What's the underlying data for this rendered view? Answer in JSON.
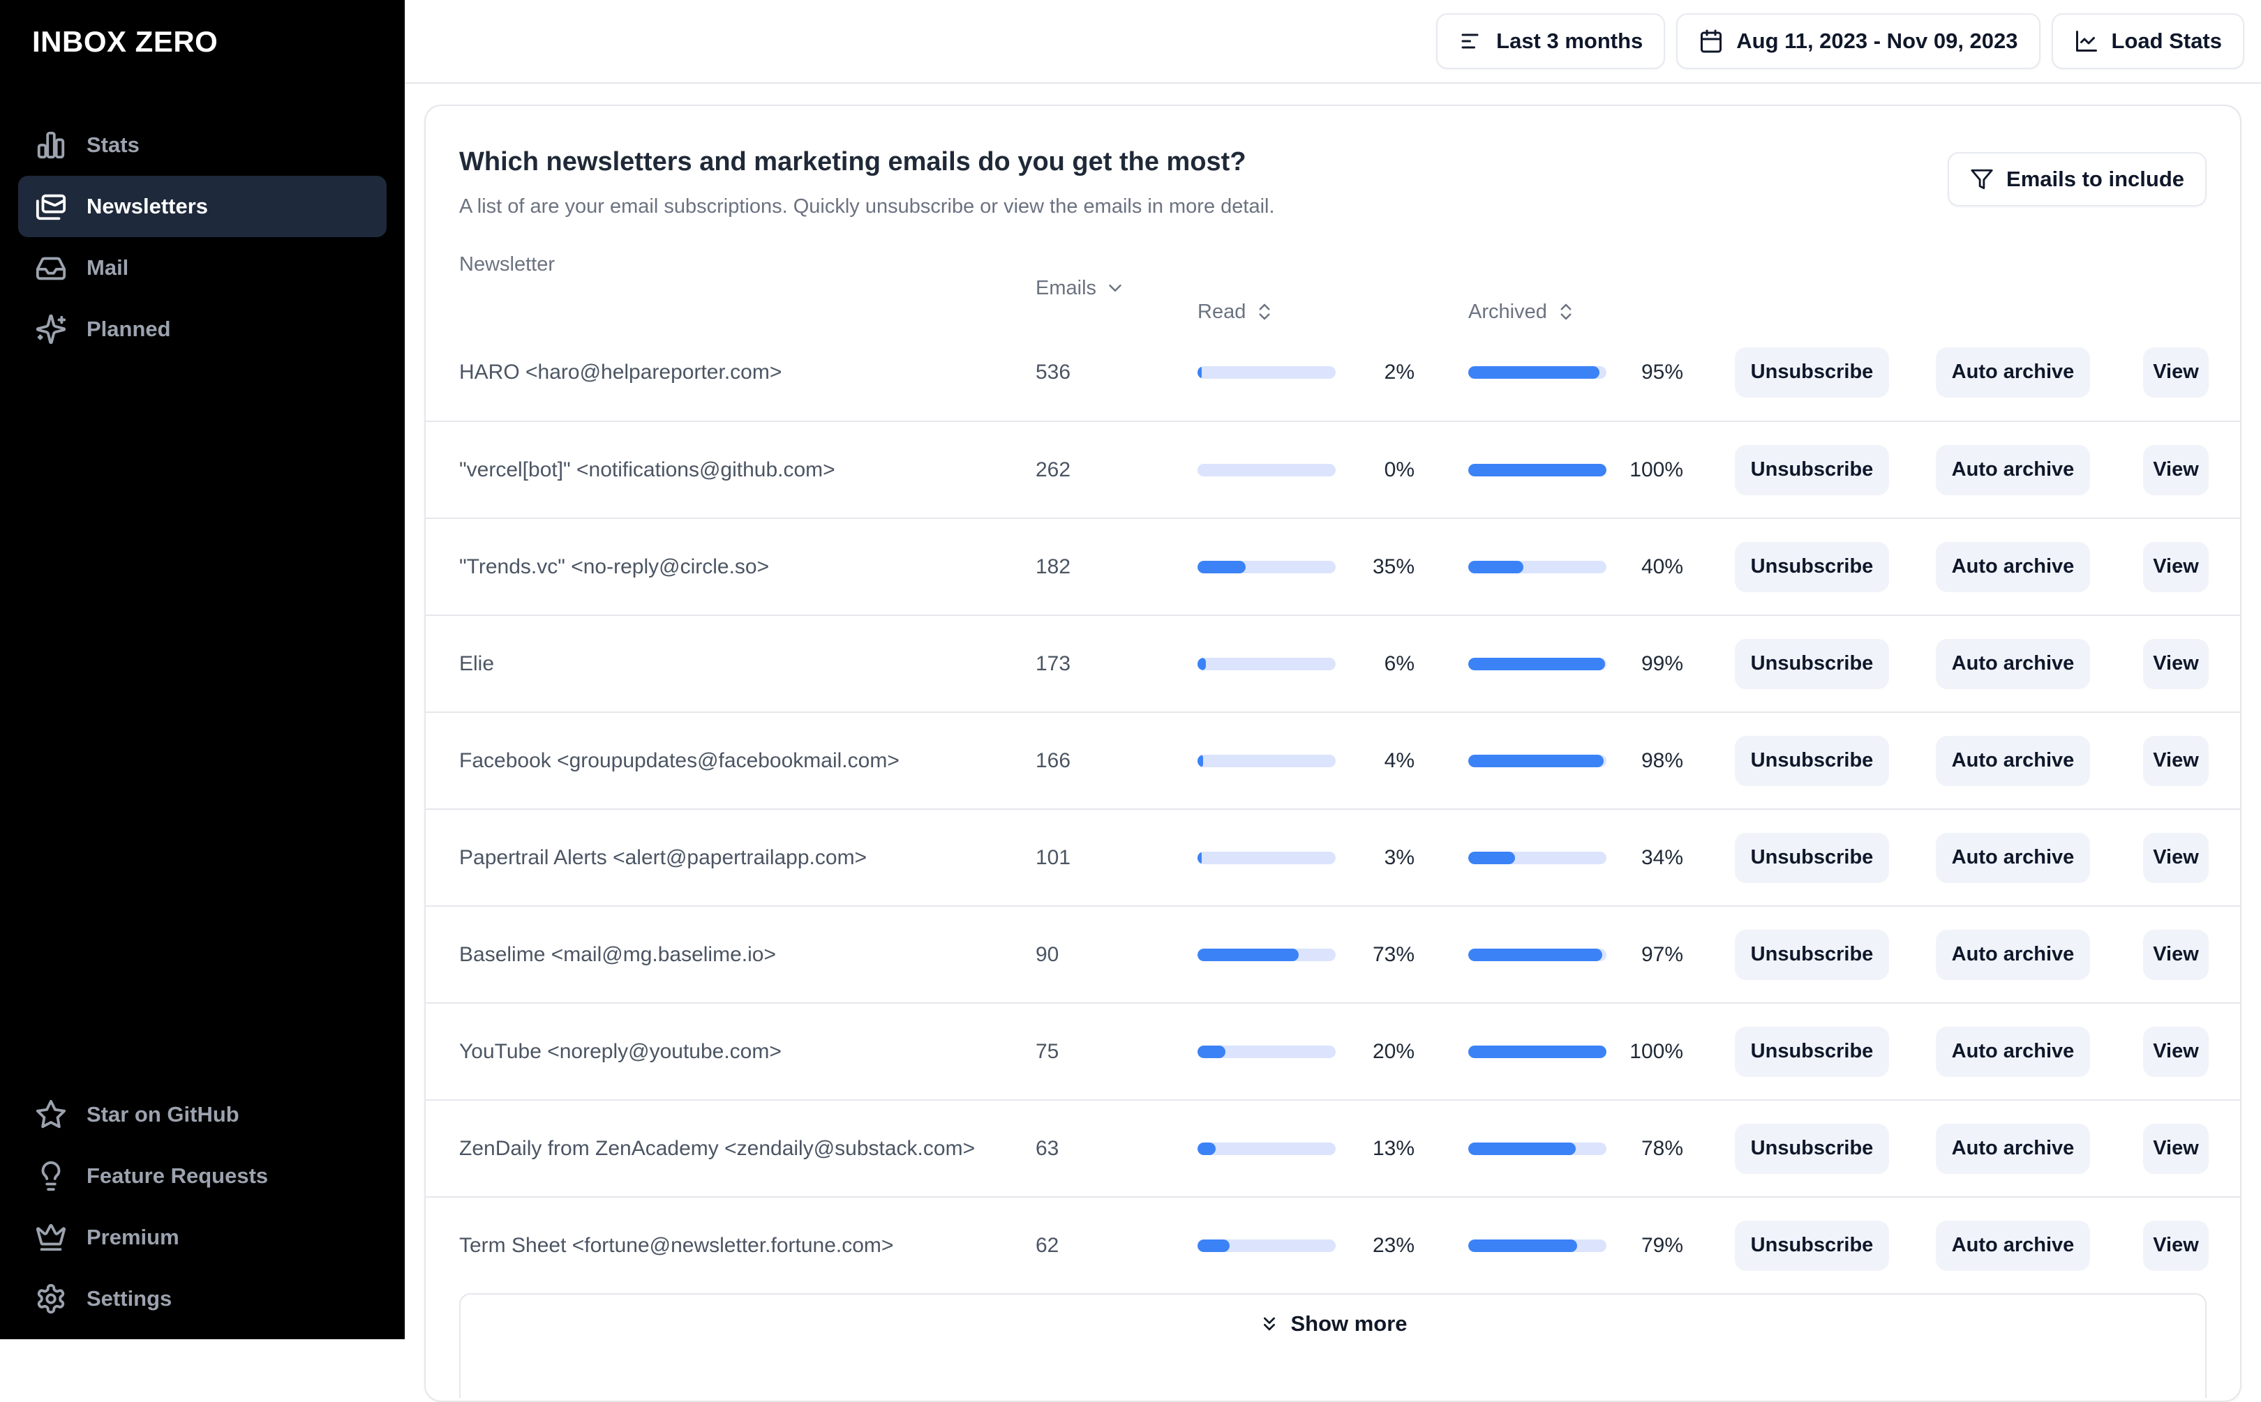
{
  "sidebar": {
    "logo": "INBOX ZERO",
    "nav": [
      {
        "label": "Stats",
        "icon": "bar-chart-icon",
        "active": false
      },
      {
        "label": "Newsletters",
        "icon": "newsletters-icon",
        "active": true
      },
      {
        "label": "Mail",
        "icon": "inbox-icon",
        "active": false
      },
      {
        "label": "Planned",
        "icon": "sparkles-icon",
        "active": false
      }
    ],
    "footer_nav": [
      {
        "label": "Star on GitHub",
        "icon": "star-icon"
      },
      {
        "label": "Feature Requests",
        "icon": "lightbulb-icon"
      },
      {
        "label": "Premium",
        "icon": "crown-icon"
      },
      {
        "label": "Settings",
        "icon": "gear-icon"
      }
    ]
  },
  "topbar": {
    "period_button": {
      "label": "Last 3 months",
      "icon": "filter-lines-icon"
    },
    "date_button": {
      "label": "Aug 11, 2023 - Nov 09, 2023",
      "icon": "calendar-icon"
    },
    "load_stats_button": {
      "label": "Load Stats",
      "icon": "line-chart-icon"
    }
  },
  "panel": {
    "title": "Which newsletters and marketing emails do you get the most?",
    "subtitle": "A list of are your email subscriptions. Quickly unsubscribe or view the emails in more detail.",
    "filter_button": {
      "label": "Emails to include",
      "icon": "funnel-icon"
    },
    "table": {
      "columns": [
        {
          "label": "Newsletter",
          "sort": "none"
        },
        {
          "label": "Emails",
          "sort": "down"
        },
        {
          "label": "Read",
          "sort": "updown"
        },
        {
          "label": "Archived",
          "sort": "updown"
        }
      ],
      "actions": [
        "Unsubscribe",
        "Auto archive",
        "View"
      ],
      "rows": [
        {
          "name": "HARO <haro@helpareporter.com>",
          "emails": 536,
          "read_pct": 2,
          "archived_pct": 95
        },
        {
          "name": "\"vercel[bot]\" <notifications@github.com>",
          "emails": 262,
          "read_pct": 0,
          "archived_pct": 100
        },
        {
          "name": "\"Trends.vc\" <no-reply@circle.so>",
          "emails": 182,
          "read_pct": 35,
          "archived_pct": 40
        },
        {
          "name": "Elie",
          "emails": 173,
          "read_pct": 6,
          "archived_pct": 99
        },
        {
          "name": "Facebook <groupupdates@facebookmail.com>",
          "emails": 166,
          "read_pct": 4,
          "archived_pct": 98
        },
        {
          "name": "Papertrail Alerts <alert@papertrailapp.com>",
          "emails": 101,
          "read_pct": 3,
          "archived_pct": 34
        },
        {
          "name": "Baselime <mail@mg.baselime.io>",
          "emails": 90,
          "read_pct": 73,
          "archived_pct": 97
        },
        {
          "name": "YouTube <noreply@youtube.com>",
          "emails": 75,
          "read_pct": 20,
          "archived_pct": 100
        },
        {
          "name": "ZenDaily from ZenAcademy <zendaily@substack.com>",
          "emails": 63,
          "read_pct": 13,
          "archived_pct": 78
        },
        {
          "name": "Term Sheet <fortune@newsletter.fortune.com>",
          "emails": 62,
          "read_pct": 23,
          "archived_pct": 79
        }
      ]
    },
    "show_more": {
      "label": "Show more",
      "icon": "chevrons-down-icon"
    }
  },
  "colors": {
    "sidebar_bg": "#000000",
    "sidebar_active_bg": "#1e293b",
    "accent_fill": "#3b82f6",
    "bar_track": "#dbe4fc",
    "border": "#e5e7eb",
    "muted_text": "#6b7280",
    "dark_text": "#111827",
    "button_bg": "#f0f3f9"
  }
}
